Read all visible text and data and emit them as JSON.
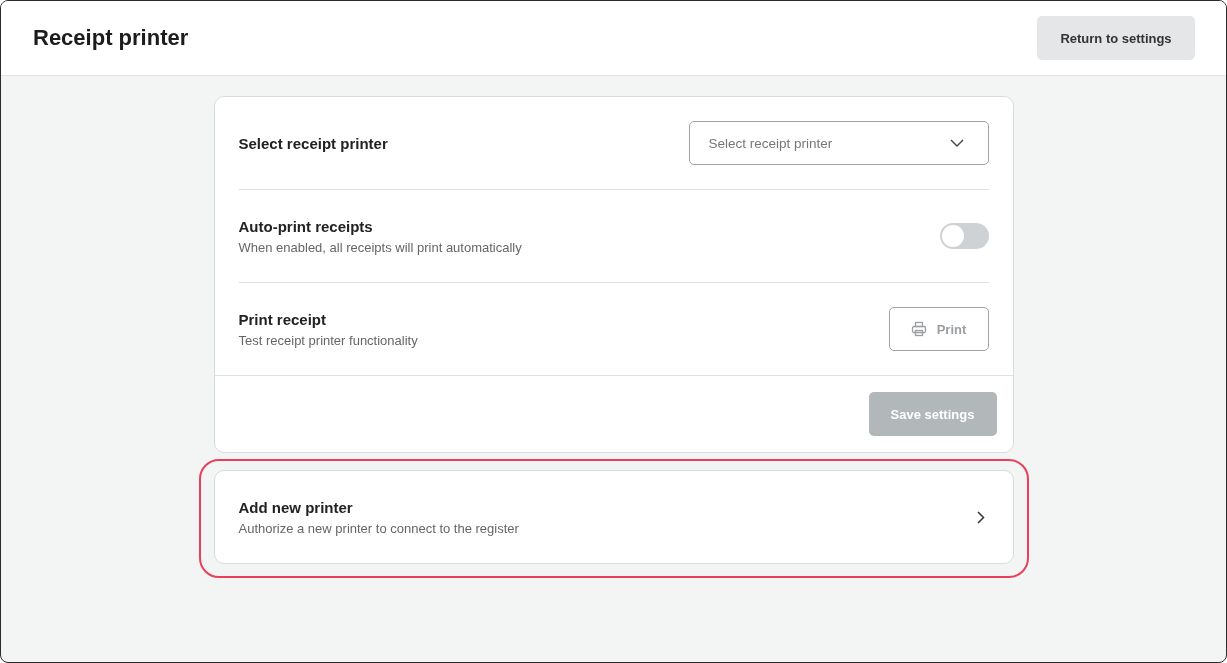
{
  "header": {
    "title": "Receipt printer",
    "button": "Return to settings"
  },
  "settings": [
    {
      "kind": "select",
      "title": "Select receipt printer",
      "placeholder": "Select receipt printer"
    },
    {
      "kind": "toggle",
      "title": "Auto-print receipts",
      "description": "When enabled, all receipts will print automatically",
      "on": false
    },
    {
      "kind": "action",
      "title": "Print receipt",
      "description": "Test receipt printer functionality",
      "button": "Print",
      "disabled": true
    }
  ],
  "save_button": {
    "label": "Save settings",
    "disabled": true
  },
  "add_printer": {
    "title": "Add new printer",
    "description": "Authorize a new printer to connect to the register",
    "highlighted": true
  }
}
